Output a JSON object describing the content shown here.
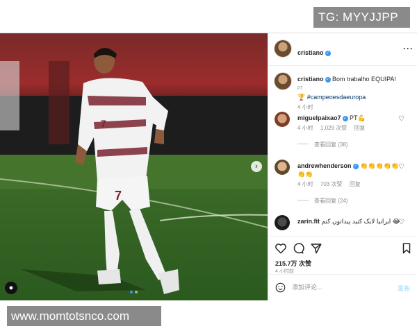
{
  "watermarks": {
    "top": "TG: MYYJJPP",
    "bottom": "www.momtotsnco.com"
  },
  "post": {
    "author": "cristiano",
    "photo": {
      "jersey_number": "7",
      "carousel_dots": 2,
      "active_dot": 1
    }
  },
  "caption": {
    "username": "cristiano",
    "text": "Bom trabalho EQUIPA! ",
    "flag": "PT",
    "hashtag": "#campeoesdaeuropa",
    "time": "4 小时"
  },
  "comments": [
    {
      "username": "miguelpaixao7",
      "text": "PT💪",
      "time": "4 小时",
      "likes": "1,029 次赞",
      "reply_label": "回复",
      "view_replies": "查看回复 (38)"
    },
    {
      "username": "andrewhenderson",
      "text": "👏👏👏👏👏👏👏",
      "time": "4 小时",
      "likes": "703 次赞",
      "reply_label": "回复",
      "view_replies": "查看回复 (24)"
    },
    {
      "username": "zarin.fit",
      "text": "ایرانیا لایک کنید پیداتون کنم 😂"
    }
  ],
  "actions": {
    "likes_count": "215.7万 次赞",
    "time_ago": "4 小时前"
  },
  "composer": {
    "placeholder": "添加评论...",
    "post_label": "发布"
  },
  "colors": {
    "accent": "#3897f0",
    "link": "#00376b",
    "muted": "#8e8e8e"
  },
  "icons": [
    "more-icon",
    "heart-icon",
    "comment-icon",
    "share-icon",
    "bookmark-icon",
    "emoji-icon",
    "tag-user-icon",
    "chevron-right-icon",
    "verified-icon"
  ]
}
